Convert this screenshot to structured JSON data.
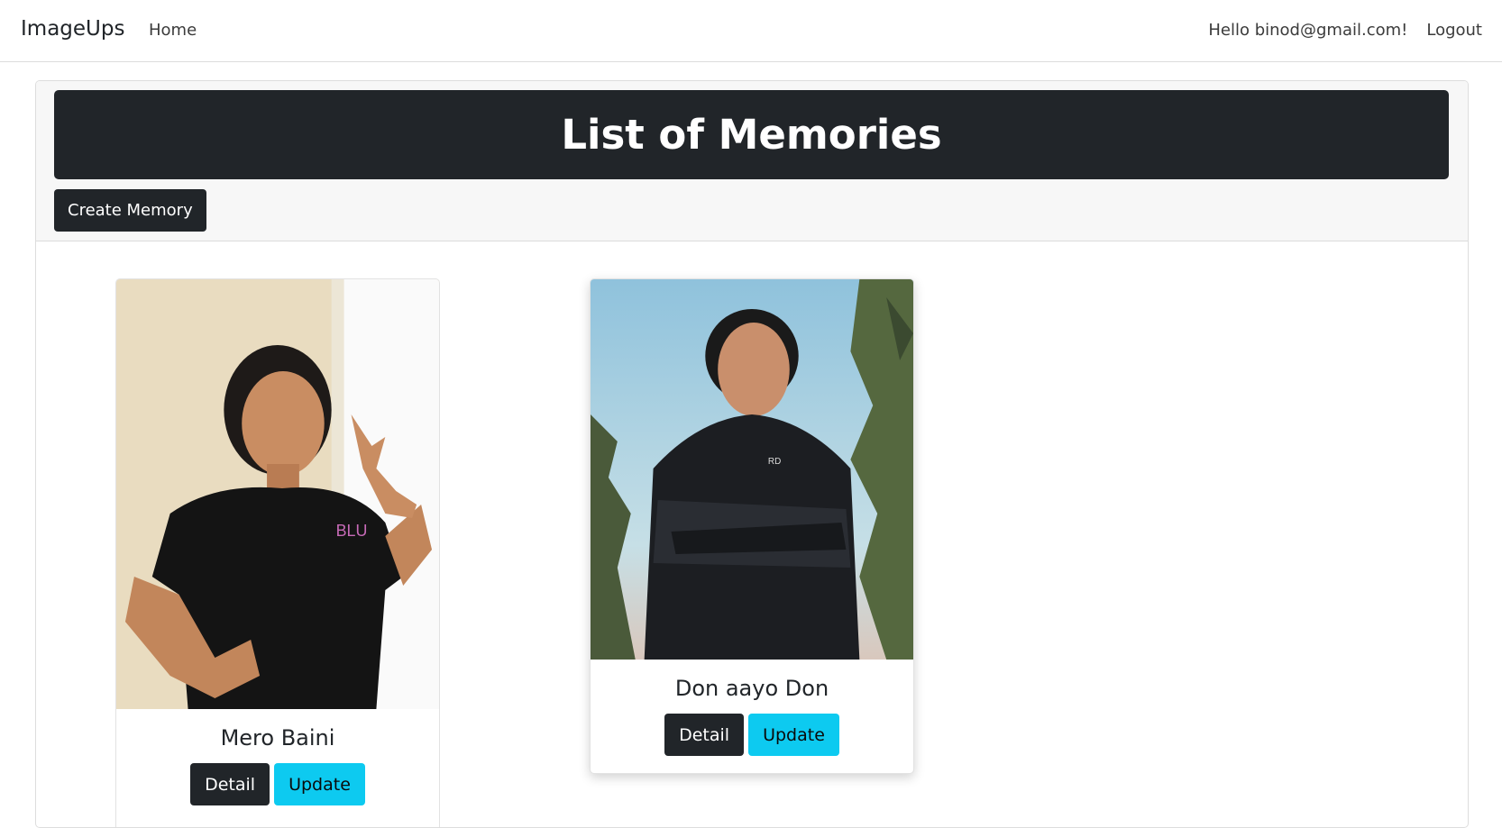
{
  "navbar": {
    "brand": "ImageUps",
    "home": "Home",
    "greeting": "Hello binod@gmail.com!",
    "logout": "Logout"
  },
  "header": {
    "title": "List of Memories",
    "create_button": "Create Memory"
  },
  "memories": [
    {
      "title": "Mero Baini",
      "detail_label": "Detail",
      "update_label": "Update"
    },
    {
      "title": "Don aayo Don",
      "detail_label": "Detail",
      "update_label": "Update"
    }
  ],
  "colors": {
    "dark": "#212529",
    "info": "#0dcaf0"
  }
}
